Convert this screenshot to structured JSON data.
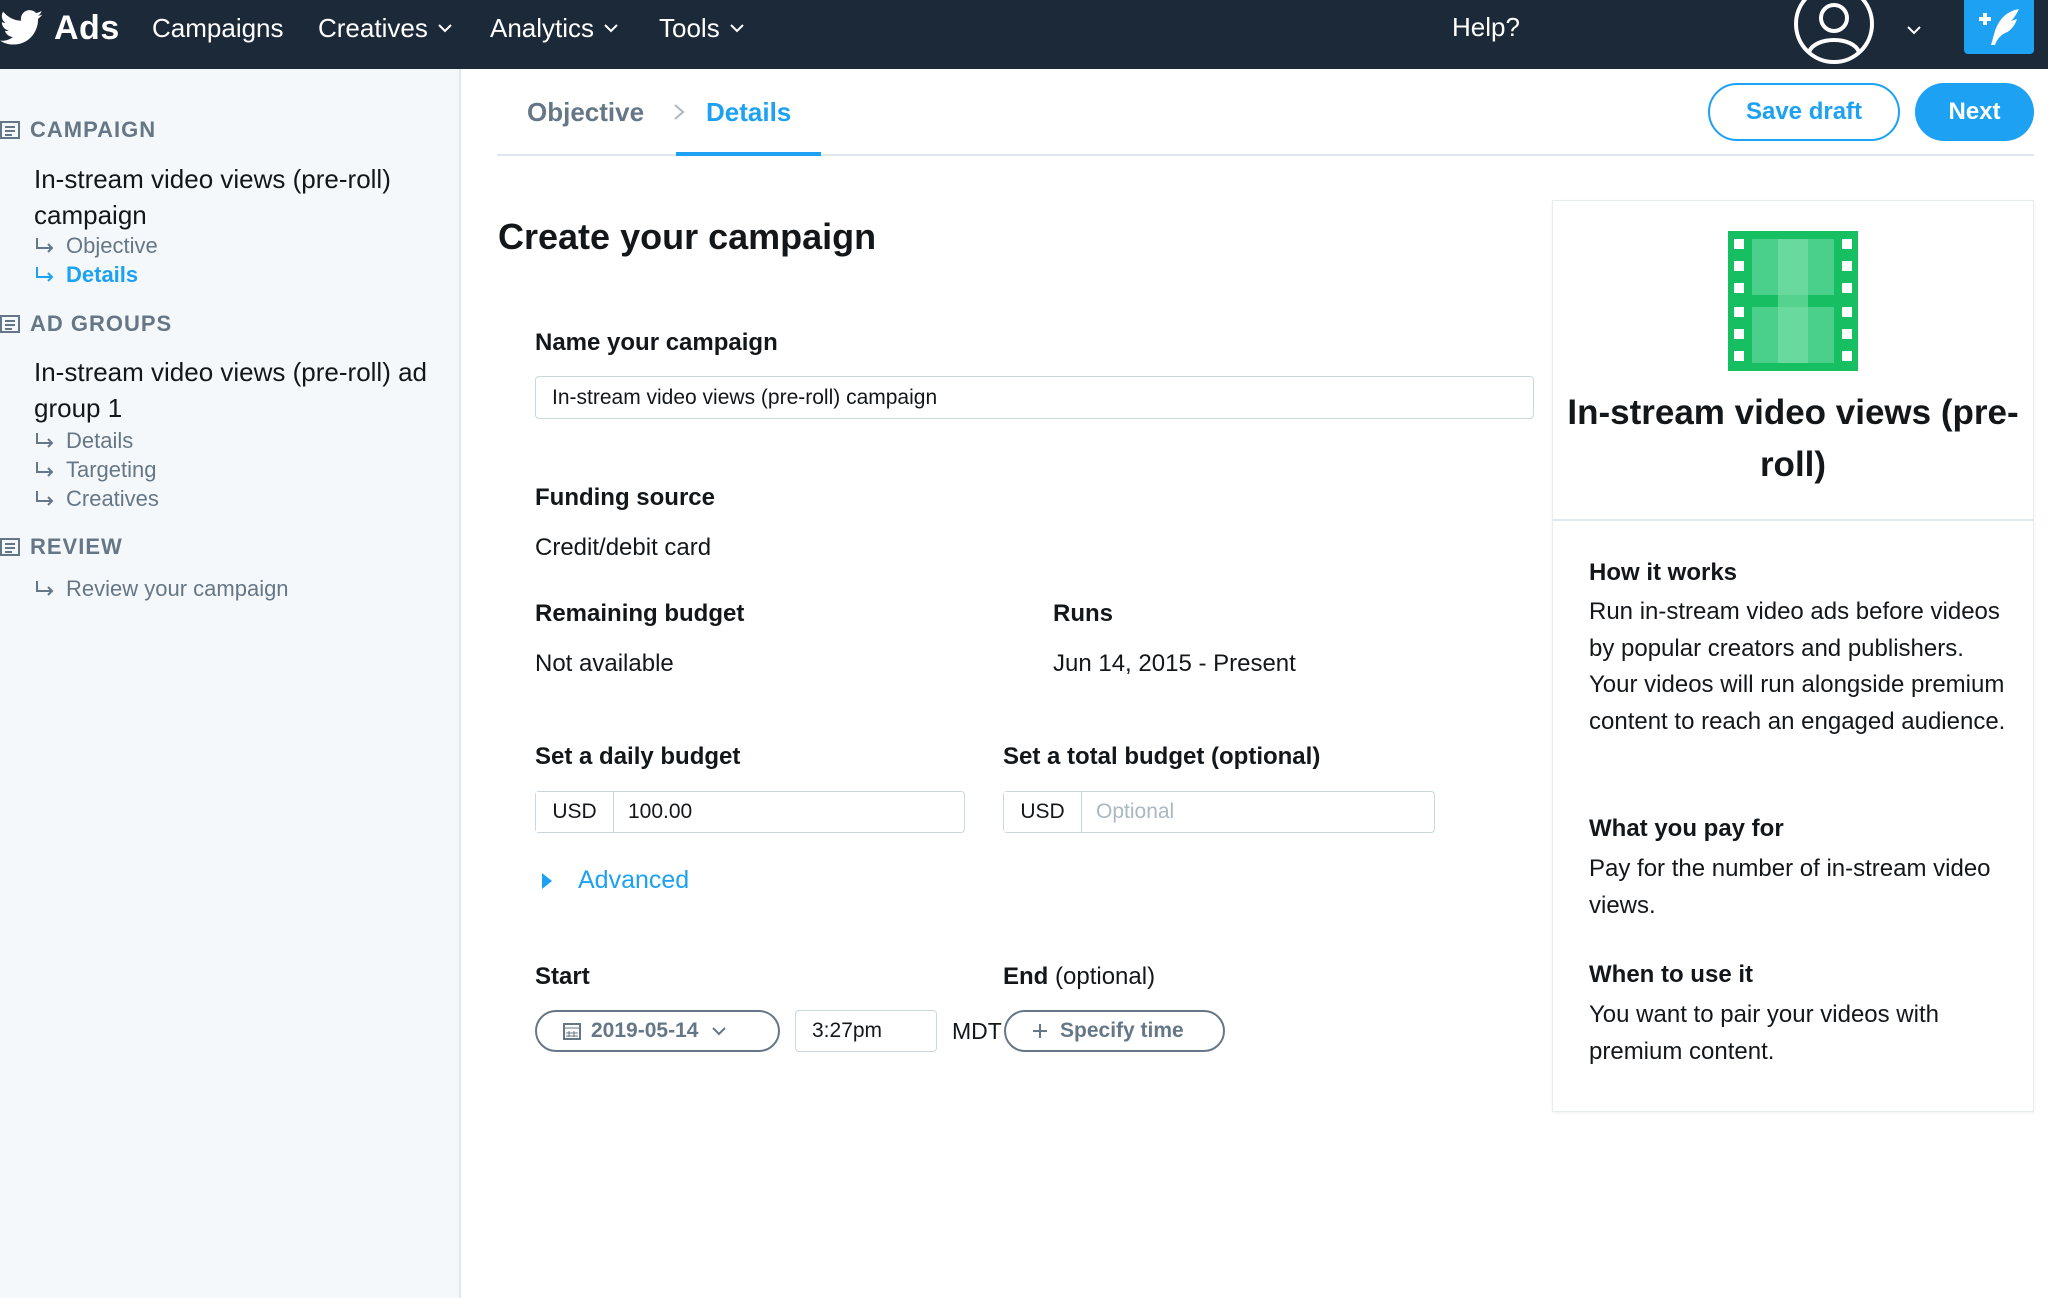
{
  "topbar": {
    "brand": "Ads",
    "nav": [
      {
        "label": "Campaigns",
        "has_dropdown": false
      },
      {
        "label": "Creatives",
        "has_dropdown": true
      },
      {
        "label": "Analytics",
        "has_dropdown": true
      },
      {
        "label": "Tools",
        "has_dropdown": true
      }
    ],
    "help": "Help?",
    "icons": [
      "twitter-bird-icon",
      "user-avatar-icon",
      "chevron-down-icon",
      "compose-tweet-icon"
    ]
  },
  "sidebar": {
    "campaign_header": "CAMPAIGN",
    "campaign_name": "In-stream video views (pre-roll) campaign",
    "campaign_steps": [
      {
        "label": "Objective",
        "active": false
      },
      {
        "label": "Details",
        "active": true
      }
    ],
    "adgroups_header": "AD GROUPS",
    "adgroup_name": "In-stream video views (pre-roll) ad group 1",
    "adgroup_steps": [
      {
        "label": "Details",
        "active": false
      },
      {
        "label": "Targeting",
        "active": false
      },
      {
        "label": "Creatives",
        "active": false
      }
    ],
    "review_header": "REVIEW",
    "review_steps": [
      {
        "label": "Review your campaign",
        "active": false
      }
    ]
  },
  "breadcrumb": {
    "objective": "Objective",
    "details": "Details"
  },
  "actions": {
    "save_draft": "Save draft",
    "next": "Next"
  },
  "form": {
    "title": "Create your campaign",
    "name_label": "Name your campaign",
    "name_value": "In-stream video views (pre-roll) campaign",
    "funding_label": "Funding source",
    "funding_value": "Credit/debit card",
    "remaining_label": "Remaining budget",
    "remaining_value": "Not available",
    "runs_label": "Runs",
    "runs_value": "Jun 14, 2015 - Present",
    "daily_label": "Set a daily budget",
    "daily_currency": "USD",
    "daily_value": "100.00",
    "total_label": "Set a total budget (optional)",
    "total_label_main": "Set a total budget (optional)",
    "total_currency": "USD",
    "total_placeholder": "Optional",
    "advanced": "Advanced",
    "start_label": "Start",
    "start_date": "2019-05-14",
    "start_time": "3:27pm",
    "timezone": "MDT",
    "end_label": "End",
    "end_optional": "(optional)",
    "specify_time": "Specify time"
  },
  "info_card": {
    "title": "In-stream video views (pre-roll)",
    "icon": "film-strip-icon",
    "icon_color": "#17bf63",
    "sections": [
      {
        "heading": "How it works",
        "body": "Run in-stream video ads before videos by popular creators and publishers. Your videos will run alongside premium content to reach an engaged audience."
      },
      {
        "heading": "What you pay for",
        "body": "Pay for the number of in-stream video views."
      },
      {
        "heading": "When to use it",
        "body": "You want to pair your videos with premium content."
      }
    ]
  },
  "colors": {
    "topbar_bg": "#1c2938",
    "accent": "#1da1f2",
    "muted": "#657786",
    "sidebar_bg": "#f5f8fa"
  }
}
